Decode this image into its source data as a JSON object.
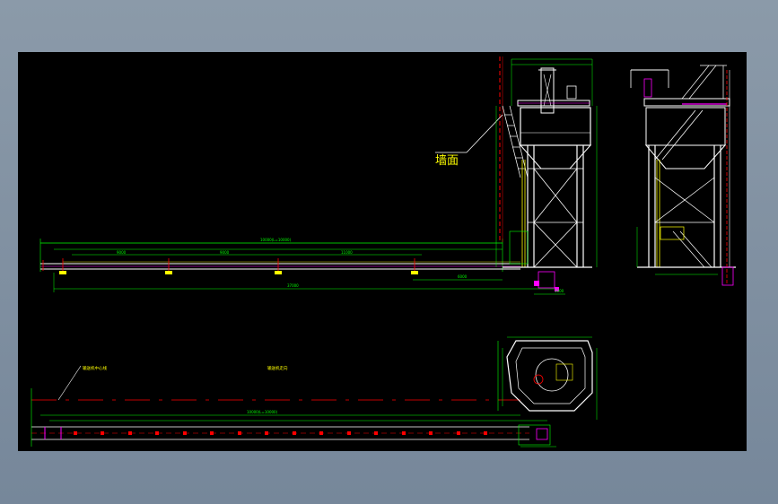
{
  "drawing": {
    "background": "#000000",
    "viewer_background": "#7e8e9e",
    "annotations": {
      "wall_label": "墙面"
    },
    "colors": {
      "structure": "#ffffff",
      "dimension": "#00ff00",
      "text": "#ffff00",
      "centerline": "#ff0000",
      "accent": "#ff00ff",
      "guide": "#00ffff"
    }
  }
}
